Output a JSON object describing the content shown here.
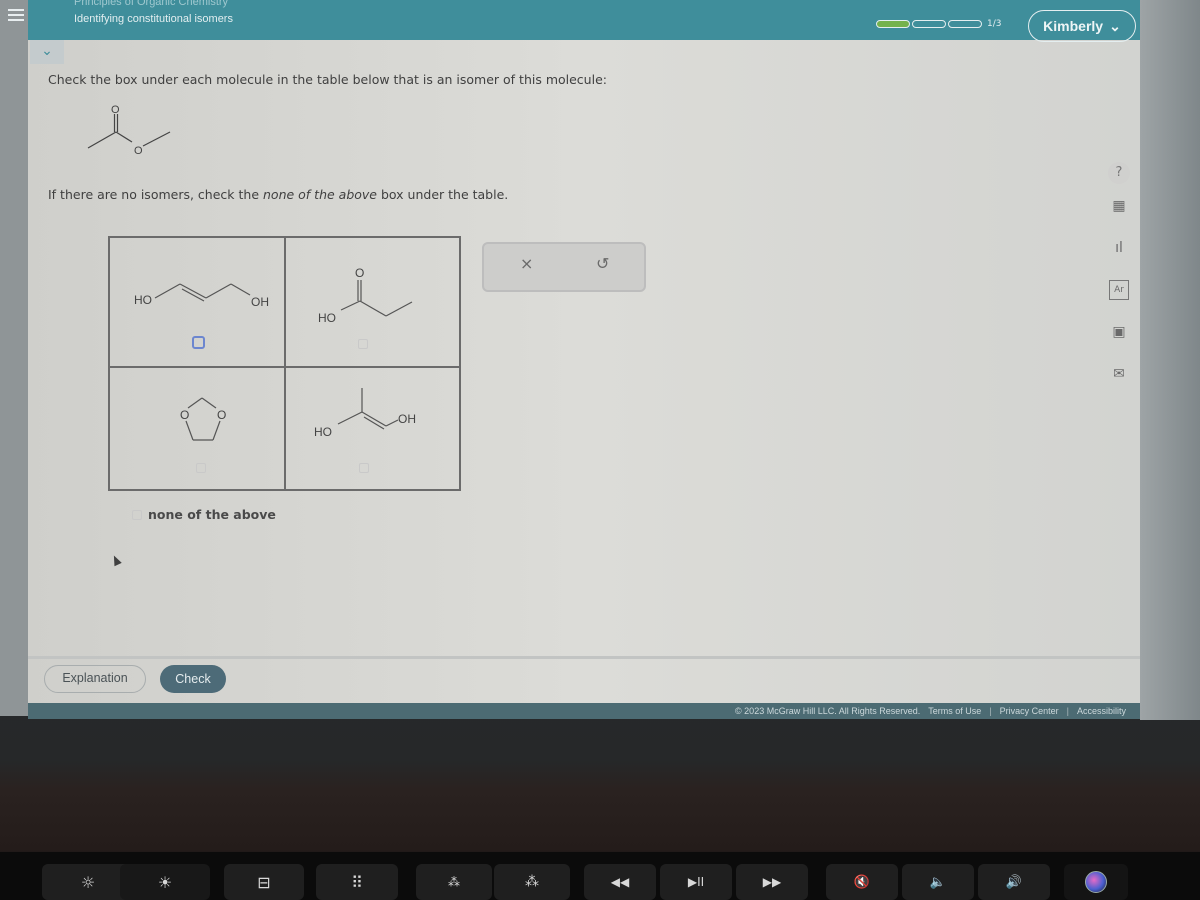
{
  "header": {
    "course": "Principles of Organic Chemistry",
    "topic": "Identifying constitutional isomers",
    "progress": {
      "completed": 1,
      "total": 3,
      "label": "1/3"
    },
    "user_name": "Kimberly",
    "colors": {
      "header_bg": "#3f8e9b",
      "progress_fill": "#74b24d"
    }
  },
  "question": {
    "instruction": "Check the box under each molecule in the table below that is an isomer of this molecule:",
    "reference_molecule": {
      "name": "methyl acetate",
      "atom_labels": [
        "O",
        "O"
      ]
    },
    "note_prefix": "If there are no isomers, check the ",
    "note_emphasis": "none of the above",
    "note_suffix": " box under the table."
  },
  "answer_table": {
    "cells": [
      {
        "molecule": "but-2-ene-1,4-diol (HO-CH=CH-CH2-OH)",
        "labels": [
          "HO",
          "OH"
        ],
        "checked": false,
        "focused": true
      },
      {
        "molecule": "propanoic acid",
        "labels": [
          "O",
          "HO"
        ],
        "checked": false,
        "focused": false
      },
      {
        "molecule": "1,3-dioxolane",
        "labels": [
          "O",
          "O"
        ],
        "checked": false,
        "focused": false
      },
      {
        "molecule": "prop-1-ene-1,2-diol",
        "labels": [
          "HO",
          "OH"
        ],
        "checked": false,
        "focused": false
      }
    ],
    "none_of_the_above": {
      "label": "none of the above",
      "checked": false
    }
  },
  "tools_panel": {
    "clear_icon": "×",
    "undo_icon": "↺"
  },
  "side_tools": [
    {
      "name": "help",
      "glyph": "?"
    },
    {
      "name": "calculator",
      "glyph": "▦"
    },
    {
      "name": "chart",
      "glyph": "ıl"
    },
    {
      "name": "periodic-table",
      "glyph": "Ar"
    },
    {
      "name": "reference",
      "glyph": "▣"
    },
    {
      "name": "message",
      "glyph": "✉"
    }
  ],
  "buttons": {
    "explanation": "Explanation",
    "check": "Check"
  },
  "footer": {
    "copyright": "© 2023 McGraw Hill LLC. All Rights Reserved.",
    "terms": "Terms of Use",
    "privacy": "Privacy Center",
    "accessibility": "Accessibility"
  },
  "touchbar": {
    "keys": [
      "brightness-down",
      "brightness-up",
      "mission-control",
      "launchpad",
      "keyboard-light-down",
      "keyboard-light-up",
      "rewind",
      "play-pause",
      "fast-forward",
      "mute",
      "volume-down",
      "volume-up",
      "siri"
    ],
    "glyphs": {
      "brightness-down": "☼",
      "brightness-up": "☀",
      "mission-control": "⊟",
      "launchpad": "⠿",
      "keyboard-light-down": "⁂",
      "keyboard-light-up": "⁂",
      "rewind": "◀◀",
      "play-pause": "▶II",
      "fast-forward": "▶▶",
      "mute": "🔇",
      "volume-down": "🔈",
      "volume-up": "🔊"
    }
  }
}
